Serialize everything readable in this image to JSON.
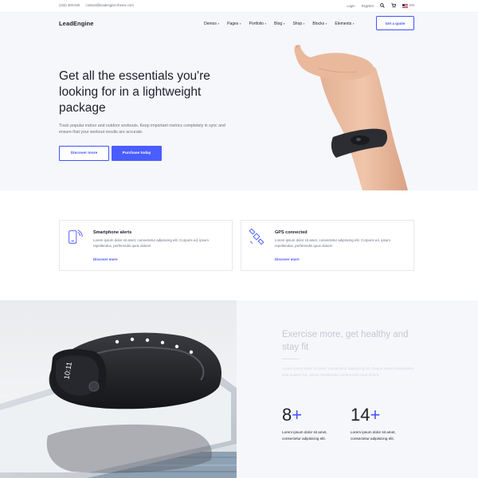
{
  "topbar": {
    "phone": "(222) 400-630",
    "email": "contact@leadengine-theme.com",
    "login": "Login",
    "register": "Register",
    "search_icon": "search-icon",
    "cart_icon": "cart-icon",
    "language": "EN"
  },
  "header": {
    "logo": "LeadEngine",
    "nav": [
      {
        "label": "Demos"
      },
      {
        "label": "Pages"
      },
      {
        "label": "Portfolio"
      },
      {
        "label": "Blog"
      },
      {
        "label": "Shop"
      },
      {
        "label": "Blocks"
      },
      {
        "label": "Elements"
      }
    ],
    "quote_button": "Get a quote"
  },
  "hero": {
    "title": "Get all the essentials you're looking for in a lightweight package",
    "subtitle": "Track popular indoor and outdoor workouts. Keep important metrics completely in sync and ensure that your workout results are accurate.",
    "discover_button": "Discover more",
    "purchase_button": "Purchase today"
  },
  "features": [
    {
      "icon": "smartphone-alert-icon",
      "title": "Smartphone alerts",
      "text": "Lorem ipsum dolor sit amet, consectetur adipiscing elit. Corporis ed, ipsum repellendus, perferendis quos dolore!",
      "link": "Discover more"
    },
    {
      "icon": "satellite-icon",
      "title": "GPS connected",
      "text": "Lorem ipsum dolor sit amet, consectetur adipiscing elit. Corporis ed, ipsum repellendus, perferendis quos dolore!",
      "link": "Discover more"
    }
  ],
  "bottom": {
    "title": "Exercise more, get healthy and stay fit",
    "paragraph": "Lorem ipsum dolor sit amet, consectetur adipiscing elit. Eaque natus consequatur ipsa quidem hic, ipsum repellendus perferendis quos dolore.",
    "stats": [
      {
        "number": "8",
        "suffix": "+",
        "text": "Lorem ipsum dolor sit amet, consectetur adipisicing elit."
      },
      {
        "number": "14",
        "suffix": "+",
        "text": "Lorem ipsum dolor sit amet, consectetur adipisicing elit."
      }
    ]
  },
  "colors": {
    "accent": "#4353ff",
    "hero_bg": "#f6f7fb",
    "text": "#1d1f2c",
    "muted": "#6b6f80"
  }
}
